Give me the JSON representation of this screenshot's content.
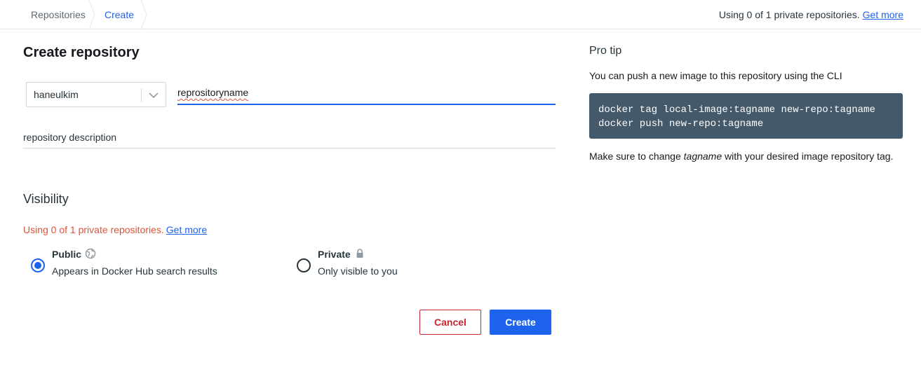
{
  "breadcrumb": {
    "items": [
      "Repositories",
      "Create"
    ]
  },
  "header": {
    "usage_text": "Using 0 of 1 private repositories.",
    "usage_link": "Get more"
  },
  "form": {
    "title": "Create repository",
    "namespace": "haneulkim",
    "repo_name_value": "reprositoryname",
    "description_placeholder": "repository description"
  },
  "visibility": {
    "heading": "Visibility",
    "usage_text": "Using 0 of 1 private repositories.",
    "usage_link": "Get more",
    "options": [
      {
        "label": "Public",
        "description": "Appears in Docker Hub search results",
        "selected": true,
        "icon": "globe-icon"
      },
      {
        "label": "Private",
        "description": "Only visible to you",
        "selected": false,
        "icon": "lock-icon"
      }
    ]
  },
  "actions": {
    "cancel_label": "Cancel",
    "create_label": "Create"
  },
  "pro_tip": {
    "title": "Pro tip",
    "intro": "You can push a new image to this repository using the CLI",
    "code_lines": [
      "docker tag local-image:tagname new-repo:tagname",
      "docker push new-repo:tagname"
    ],
    "note_before": "Make sure to change ",
    "note_em": "tagname",
    "note_after": " with your desired image repository tag."
  },
  "colors": {
    "primary": "#1d63ed",
    "danger": "#c4262e",
    "warning_text": "#e0533a",
    "code_bg": "#44596a"
  }
}
